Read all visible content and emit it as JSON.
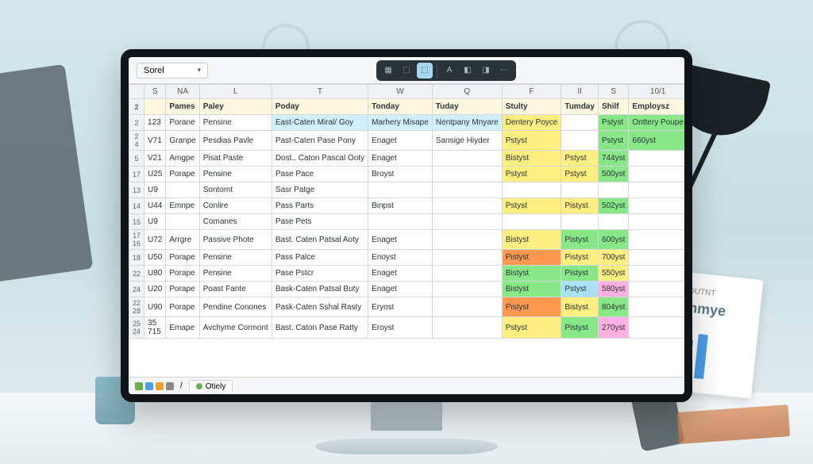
{
  "doc_name": "Sorel",
  "toolbar_active_index": 2,
  "col_headers": [
    "",
    "S",
    "NA",
    "L",
    "T",
    "W",
    "Q",
    "F",
    "II",
    "S",
    "10/1"
  ],
  "header_row": {
    "num": "2",
    "cells": [
      "",
      "Pames",
      "Paley",
      "Poday",
      "Tonday",
      "Tuday",
      "Stulty",
      "Tumday",
      "Shilf",
      "Employsz"
    ]
  },
  "header_colors": [
    "",
    "",
    "",
    "",
    "",
    "c-ltblue",
    "",
    "c-orange",
    "c-orange",
    "c-orange",
    ""
  ],
  "rows": [
    {
      "num": "2",
      "id": "123",
      "cells": [
        "Porane",
        "Pensine",
        "East-Caten Miral/ Goy",
        "Marhery Misape",
        "Nentpany Mnyare",
        "Dentery Poyce",
        "",
        "Pstyst",
        "Onttery Poupe",
        ""
      ],
      "colors": [
        "",
        "",
        "c-ltblue",
        "c-ltblue",
        "c-ltblue",
        "c-yellow",
        "",
        "c-green",
        "c-green",
        ""
      ]
    },
    {
      "num": "2 4",
      "id": "V71",
      "cells": [
        "Granpe",
        "Pesdias Pavle",
        "Past-Caten Pase Pony",
        "Enaget",
        "Sansige Hiyder",
        "Pstyst",
        "",
        "Pstyst",
        "660yst",
        ""
      ],
      "colors": [
        "",
        "",
        "",
        "",
        "",
        "c-yellow",
        "",
        "c-green",
        "c-green",
        ""
      ]
    },
    {
      "num": "5",
      "id": "V21",
      "cells": [
        "Amgpe",
        "Pisat Paste",
        "Dost.. Caton Pascal Ooty",
        "Enaget",
        "",
        "Bistyst",
        "Pstyst",
        "744yst",
        "",
        ""
      ],
      "colors": [
        "",
        "",
        "",
        "",
        "",
        "c-yellow",
        "c-yellow",
        "c-green",
        "",
        ""
      ]
    },
    {
      "num": "17",
      "id": "U25",
      "cells": [
        "Porape",
        "Pensine",
        "Pase Pace",
        "Broyst",
        "",
        "Pstyst",
        "Pstyst",
        "500yst",
        "",
        ""
      ],
      "colors": [
        "",
        "",
        "",
        "",
        "",
        "c-yellow",
        "c-yellow",
        "c-green",
        "",
        ""
      ]
    },
    {
      "num": "13",
      "id": "U9",
      "cells": [
        "",
        "Sontomt",
        "Sasr Patge",
        "",
        "",
        "",
        "",
        "",
        "",
        ""
      ],
      "colors": [
        "",
        "",
        "",
        "",
        "",
        "",
        "",
        "",
        "",
        ""
      ]
    },
    {
      "num": "14",
      "id": "U44",
      "cells": [
        "Emnpe",
        "Conlire",
        "Pass Parts",
        "Binpst",
        "",
        "Pstyst",
        "Pistyst",
        "502yst",
        "",
        ""
      ],
      "colors": [
        "",
        "",
        "",
        "",
        "",
        "c-yellow",
        "c-yellow",
        "c-green",
        "",
        ""
      ]
    },
    {
      "num": "15",
      "id": "U9",
      "cells": [
        "",
        "Comanes",
        "Pase Pets",
        "",
        "",
        "",
        "",
        "",
        "",
        ""
      ],
      "colors": [
        "",
        "",
        "",
        "",
        "",
        "",
        "",
        "",
        "",
        ""
      ]
    },
    {
      "num": "17 16",
      "id": "U72",
      "cells": [
        "Arrgre",
        "Passive Phote",
        "Bast. Caten Patsal Aoty",
        "Enaget",
        "",
        "Bistyst",
        "Pistyst",
        "600yst",
        "",
        ""
      ],
      "colors": [
        "",
        "",
        "",
        "",
        "",
        "c-yellow",
        "c-green",
        "c-green",
        "",
        ""
      ]
    },
    {
      "num": "18",
      "id": "U50",
      "cells": [
        "Porape",
        "Pensine",
        "Pass Palce",
        "Enoyst",
        "",
        "Pistyst",
        "Pistyst",
        "700yst",
        "",
        ""
      ],
      "colors": [
        "",
        "",
        "",
        "",
        "",
        "c-orange2",
        "c-yellow",
        "c-yellow",
        "",
        ""
      ]
    },
    {
      "num": "22",
      "id": "U80",
      "cells": [
        "Porape",
        "Pensine",
        "Pase Pstcr",
        "Enaget",
        "",
        "Bistyst",
        "Pistyst",
        "550yst",
        "",
        ""
      ],
      "colors": [
        "",
        "",
        "",
        "",
        "",
        "c-green",
        "c-green",
        "c-yellow",
        "",
        ""
      ]
    },
    {
      "num": "24",
      "id": "U20",
      "cells": [
        "Porape",
        "Poast Fante",
        "Bask-Caten Patsal Buty",
        "Enaget",
        "",
        "Bistyst",
        "Pstyst",
        "580yst",
        "",
        ""
      ],
      "colors": [
        "",
        "",
        "",
        "",
        "",
        "c-green",
        "c-blue",
        "c-pink",
        "",
        ""
      ]
    },
    {
      "num": "22 28",
      "id": "U90",
      "cells": [
        "Porape",
        "Pendine Conones",
        "Pask-Caten Sshal Rasty",
        "Eryost",
        "",
        "Pistyst",
        "Bistyst",
        "804yst",
        "",
        ""
      ],
      "colors": [
        "",
        "",
        "",
        "",
        "",
        "c-orange2",
        "c-yellow",
        "c-green",
        "",
        ""
      ]
    },
    {
      "num": "25 24",
      "id": "35 715",
      "cells": [
        "Emape",
        "Avchyme Cormont",
        "Bast. Caton Pase Ratty",
        "Eroyst",
        "",
        "Pstyst",
        "Pistyst",
        "270yst",
        "",
        ""
      ],
      "colors": [
        "",
        "",
        "",
        "",
        "",
        "c-yellow",
        "c-green",
        "c-pink",
        "",
        ""
      ]
    }
  ],
  "sheet_tab": "Otiely",
  "calendar": {
    "line1": "DUTNT",
    "line2": "Emmye"
  }
}
